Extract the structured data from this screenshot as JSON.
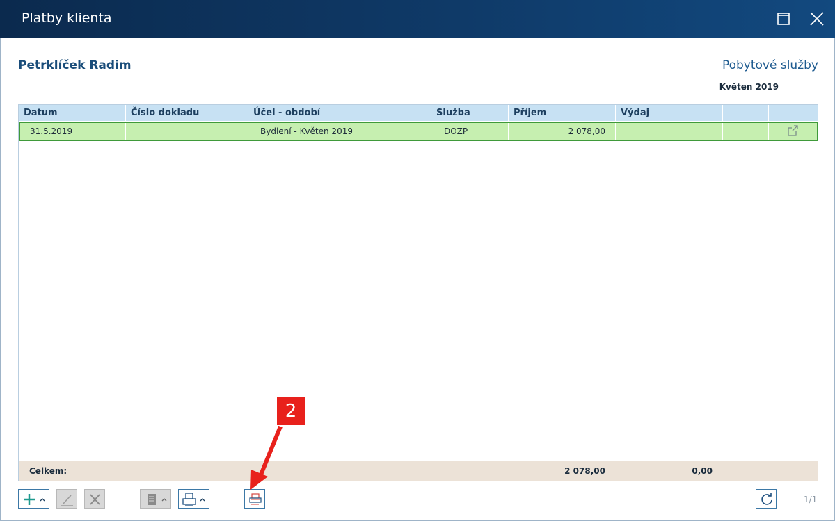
{
  "window": {
    "title": "Platby klienta"
  },
  "header": {
    "client_name": "Petrklíček Radim",
    "service": "Pobytové služby",
    "period": "Květen 2019"
  },
  "table": {
    "columns": [
      "Datum",
      "Číslo dokladu",
      "Účel - období",
      "Služba",
      "Příjem",
      "Výdaj",
      "",
      ""
    ],
    "rows": [
      {
        "datum": "31.5.2019",
        "cislo": "",
        "ucel": "Bydlení - Květen 2019",
        "sluzba": "DOZP",
        "prijem": "2 078,00",
        "vydaj": ""
      }
    ],
    "footer": {
      "label": "Celkem:",
      "prijem_total": "2 078,00",
      "vydaj_total": "0,00"
    }
  },
  "toolbar": {
    "buttons": [
      "add-icon",
      "edit-icon",
      "delete-icon",
      "document-icon",
      "print-icon",
      "print-report-icon",
      "refresh-icon"
    ]
  },
  "pager": {
    "text": "1/1"
  },
  "annotation": {
    "badge": "2",
    "color": "#e8211c"
  },
  "colors": {
    "titlebar": "#0f3a68",
    "selected_row": "#c6efb0",
    "selected_border": "#3f9a3a",
    "header_row": "#c7e1f3",
    "footer_row": "#ece2d7"
  }
}
